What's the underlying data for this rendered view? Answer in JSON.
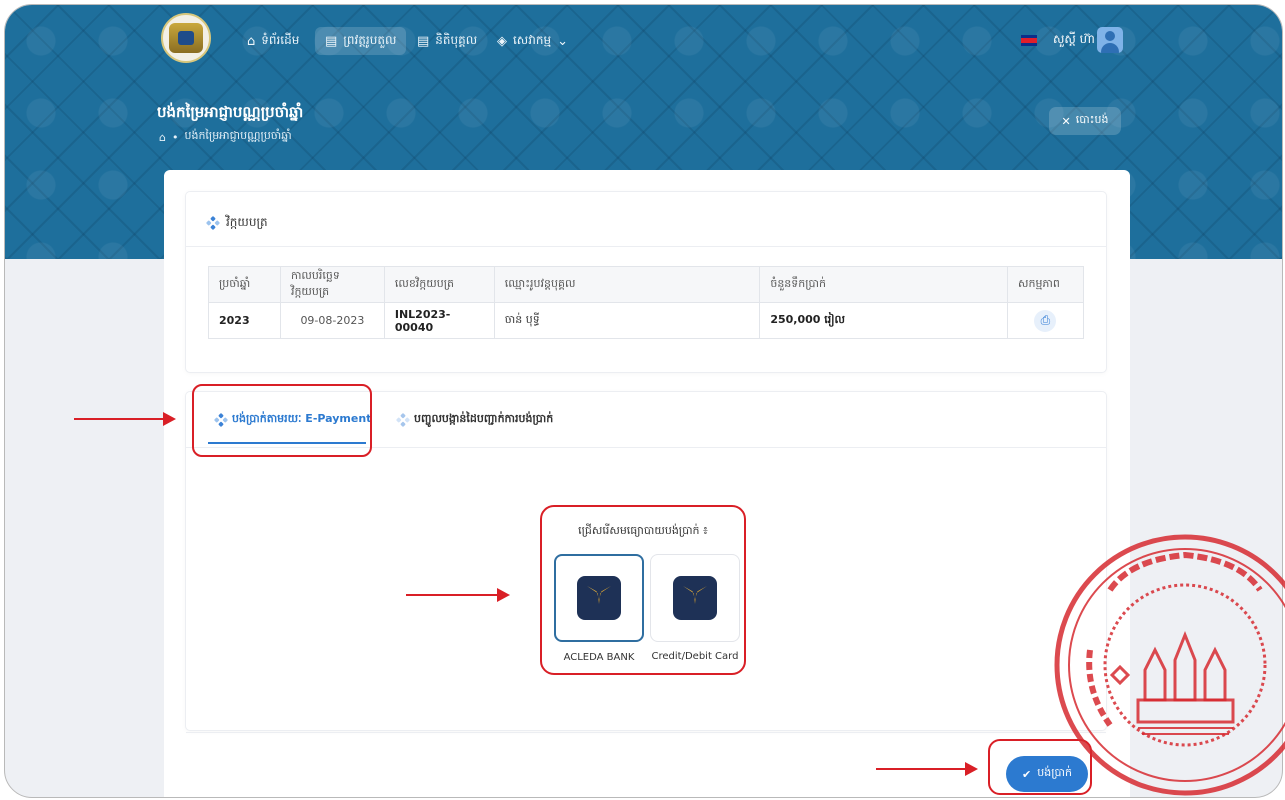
{
  "nav": {
    "items": [
      {
        "label": "ទំព័រដើម",
        "icon": "home-icon"
      },
      {
        "label": "ព្រវត្តរូបតួល",
        "icon": "document-icon"
      },
      {
        "label": "និតិបុគ្គល",
        "icon": "document-icon"
      },
      {
        "label": "សេវាកម្ម",
        "icon": "layers-icon"
      }
    ],
    "greeting": "សួស្តី ហ៊ា"
  },
  "header": {
    "title": "បង់កម្រៃអាជ្ញាបណ្ណប្រចាំឆ្នាំ",
    "breadcrumb": "បង់កម្រៃអាជ្ញាបណ្ណប្រចាំឆ្នាំ",
    "cancel_label": "បោះបង់"
  },
  "invoice": {
    "section_title": "វិក្កយបត្រ",
    "columns": [
      "ប្រចាំឆ្នាំ",
      "កាលបរិច្ឆេទវិក្កយបត្រ",
      "លេខវិក្កយបត្រ",
      "ឈ្មោះរូបវន្តបុគ្គល",
      "ចំនួនទឹកប្រាក់",
      "សកម្មភាព"
    ],
    "row": {
      "year": "2023",
      "date": "09-08-2023",
      "number": "INL2023-00040",
      "name": "ចាន់ បុទ្ធី",
      "amount": "250,000 រៀល"
    }
  },
  "tabs": [
    {
      "label": "បង់ប្រាក់តាមរយៈ E-Payment",
      "active": true
    },
    {
      "label": "បញ្ចូលបង្កាន់ដៃបញ្ជាក់ការបង់ប្រាក់",
      "active": false
    }
  ],
  "payment": {
    "prompt": "ជ្រើសរើសមធ្យោបាយបង់ប្រាក់ ៖",
    "methods": [
      {
        "label": "ACLEDA BANK",
        "selected": true
      },
      {
        "label": "Credit/Debit Card",
        "selected": false
      }
    ],
    "pay_label": "បង់ប្រាក់"
  },
  "colors": {
    "header": "#1e6f9c",
    "accent": "#2c7ad0",
    "annotation": "#d91f26"
  }
}
